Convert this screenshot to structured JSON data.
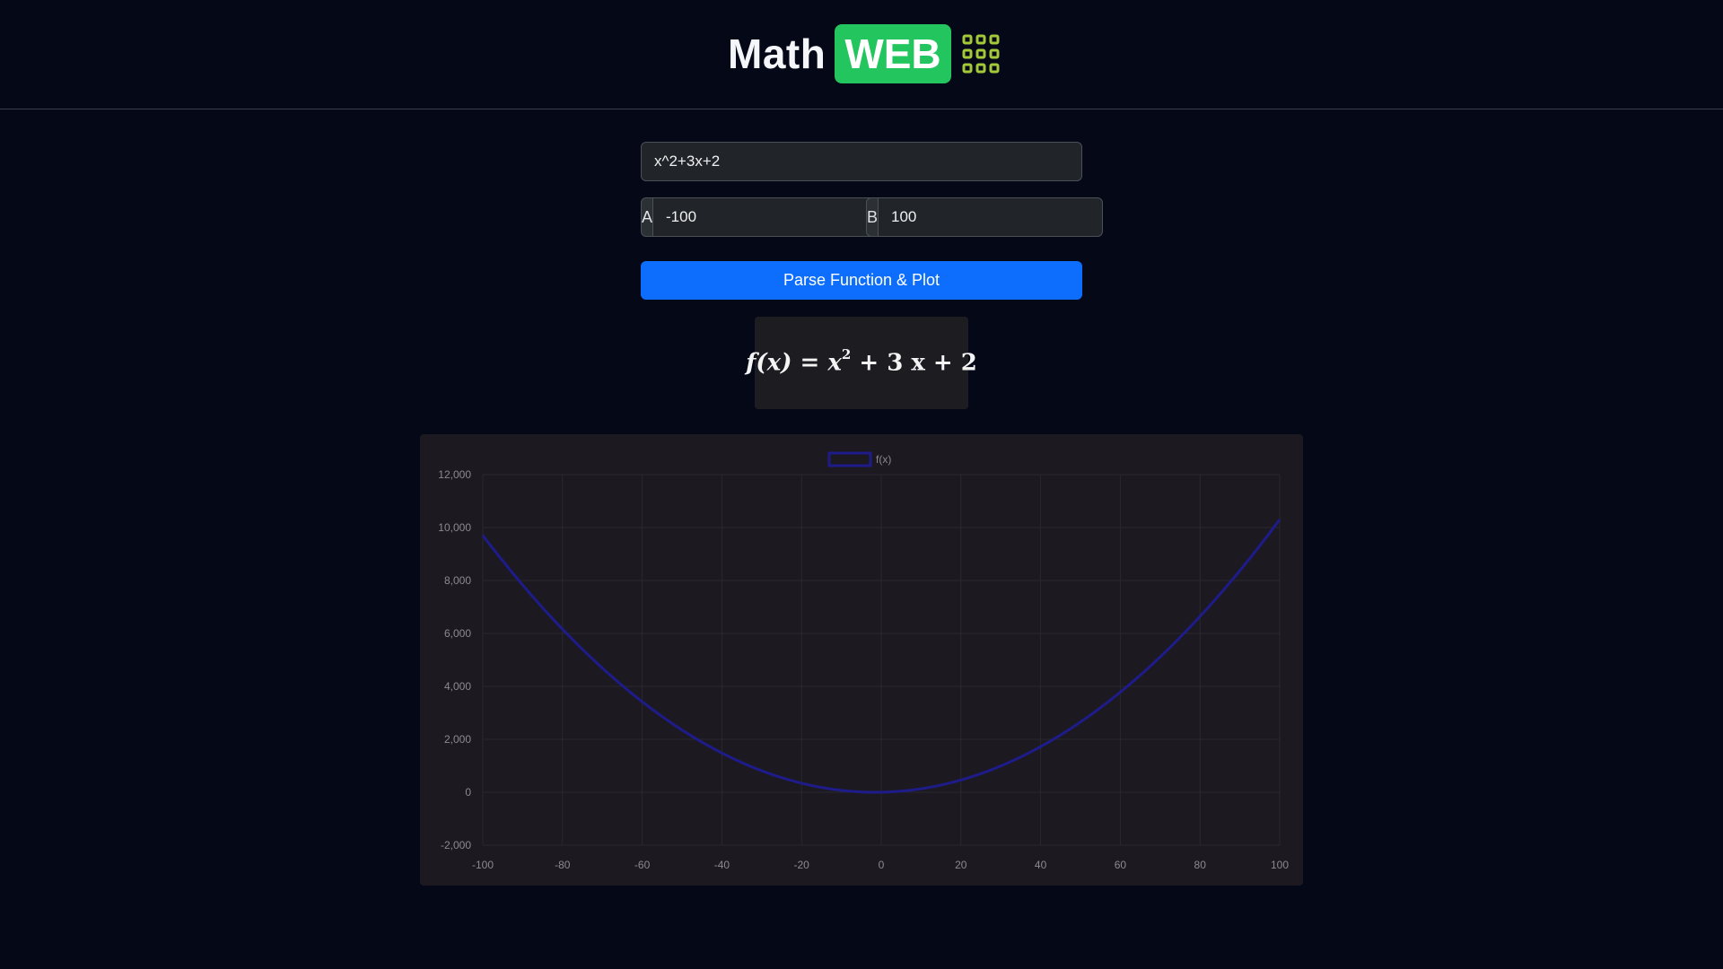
{
  "header": {
    "logo_text_1": "Math",
    "logo_text_2": "WEB",
    "logo_icon": "grid-icon",
    "colors": {
      "web_badge": "#22c55e",
      "grid_icon": "#a3c93a"
    }
  },
  "form": {
    "function_value": "x^2+3x+2",
    "a_label": "A",
    "a_value": "-100",
    "b_label": "B",
    "b_value": "100",
    "submit_label": "Parse Function & Plot",
    "colors": {
      "button": "#0d6efd"
    }
  },
  "formula": {
    "lhs": "f(x)",
    "eq": "=",
    "rhs_prefix": "x",
    "rhs_exp": "2",
    "rhs_rest": "+ 3 x + 2"
  },
  "chart_data": {
    "type": "line",
    "legend": [
      "f(x)"
    ],
    "legend_position": "top-center",
    "series": [
      {
        "name": "f(x)",
        "function": "x^2+3x+2",
        "color": "#1e1b8a",
        "x_range": [
          -100,
          100
        ]
      }
    ],
    "xlim": [
      -100,
      100
    ],
    "ylim": [
      -2000,
      12000
    ],
    "x_ticks": [
      "-100",
      "-80",
      "-60",
      "-40",
      "-20",
      "0",
      "20",
      "40",
      "60",
      "80",
      "100"
    ],
    "y_ticks": [
      "12,000",
      "10,000",
      "8,000",
      "6,000",
      "4,000",
      "2,000",
      "0",
      "-2,000"
    ],
    "grid": true
  }
}
